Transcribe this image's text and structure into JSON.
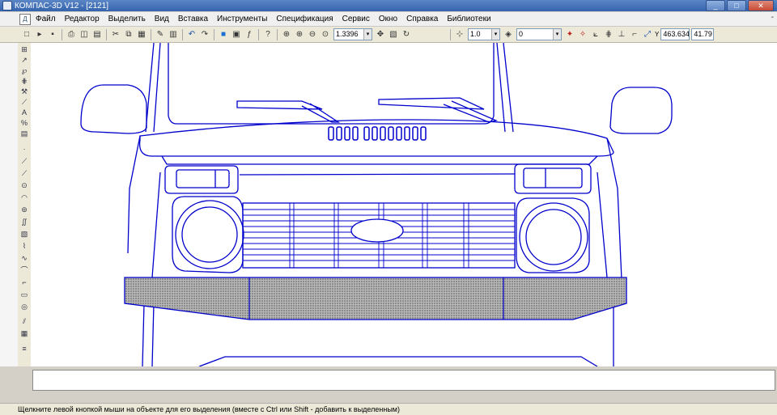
{
  "window": {
    "title": "КОМПАС-3D V12 - [2121]",
    "controls": {
      "minimize": "_",
      "maximize": "□",
      "close": "✕"
    }
  },
  "menu": {
    "items": [
      "Файл",
      "Редактор",
      "Выделить",
      "Вид",
      "Вставка",
      "Инструменты",
      "Спецификация",
      "Сервис",
      "Окно",
      "Справка",
      "Библиотеки"
    ],
    "doc_icon": "Д",
    "right_text": "-"
  },
  "toolbar": {
    "icons": [
      "new-file-icon",
      "open-icon",
      "save-icon",
      "print-icon",
      "preview-icon",
      "print-setup-icon",
      "cut-icon",
      "copy-icon",
      "paste-icon",
      "properties-icon",
      "manager-icon",
      "undo-icon",
      "redo-icon",
      "tree-icon",
      "library-icon",
      "variables-icon",
      "help-icon"
    ],
    "zoom_value": "1.3396",
    "line_scale": "1.0",
    "layer": "0",
    "coord_x": "463.634",
    "coord_y": "41.79",
    "coord_label": "Y"
  },
  "statusbar": {
    "text": "Щелкните левой кнопкой мыши на объекте для его выделения (вместе с Ctrl или Shift - добавить к выделенным)"
  },
  "drawing": {
    "stroke_color": "#0000cc",
    "bumper_fill": "#8a8a8a",
    "description_colors": {
      "canvas": "#ffffff",
      "chrome": "#d4d0c8"
    }
  }
}
